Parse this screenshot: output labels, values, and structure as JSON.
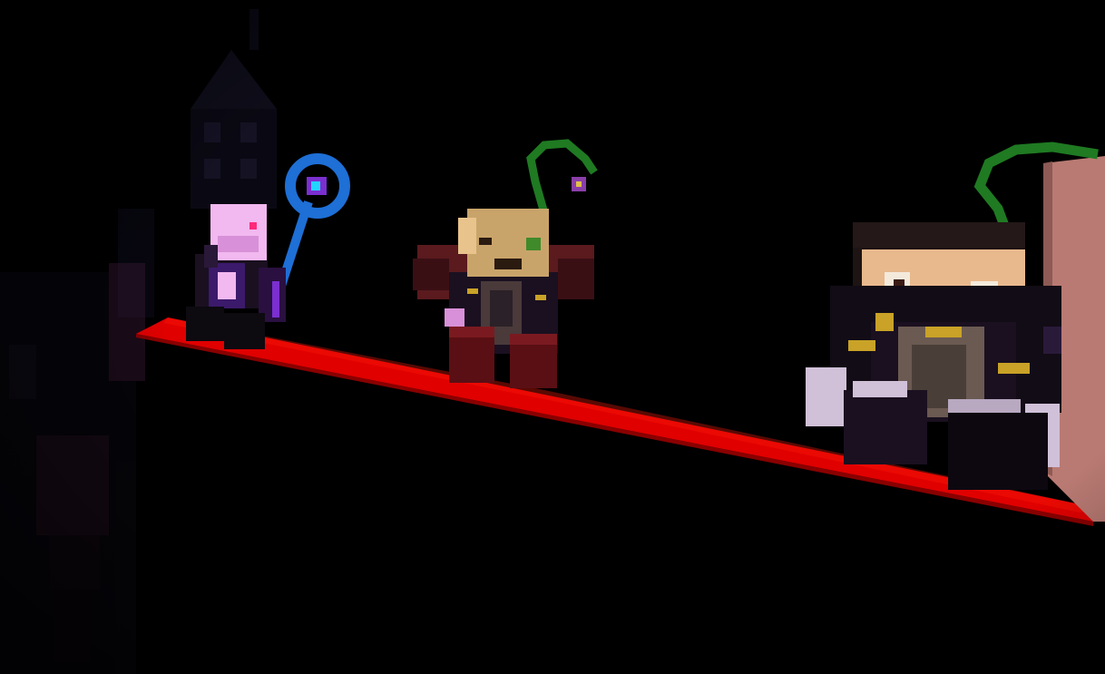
{
  "scene": {
    "type": "3d-voxel-game-render",
    "hud_text": "none visible"
  },
  "palette": {
    "background": "#000000",
    "ledge_top": "#e00000",
    "ledge_top_dark": "#b00000",
    "pillar": "#b97a73",
    "vine_green": "#1f7a22",
    "cloak_dark": "#1a1020",
    "trim_purple": "#3b1a6b",
    "gold": "#c9a227",
    "pink": "#f2b8f0",
    "skin": "#e8b98d",
    "mask_tan": "#c9a46a",
    "staff_blue": "#1e6fd6",
    "boot_maroon": "#5a0f14"
  },
  "characters": [
    {
      "id": "left",
      "description_icon": "pink-masked-mage-icon",
      "holds": "blue-staff-icon"
    },
    {
      "id": "middle",
      "description_icon": "masked-tan-character-icon",
      "accessory": "green-vine-sprout-icon"
    },
    {
      "id": "right",
      "description_icon": "dark-haired-character-icon",
      "accessory": "green-vine-sprout-icon"
    }
  ]
}
